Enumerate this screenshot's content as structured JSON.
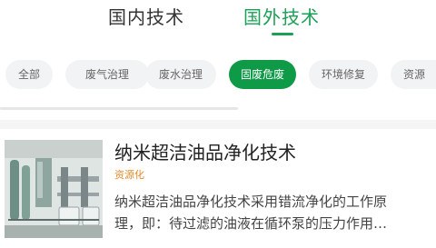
{
  "top_tabs": [
    {
      "label": "国内技术",
      "active": false
    },
    {
      "label": "国外技术",
      "active": true
    }
  ],
  "categories": [
    {
      "label": "全部",
      "active": false
    },
    {
      "label": "废气治理",
      "active": false
    },
    {
      "label": "废水治理",
      "active": false
    },
    {
      "label": "固废危废",
      "active": true
    },
    {
      "label": "环境修复",
      "active": false
    },
    {
      "label": "资源",
      "active": false
    }
  ],
  "article": {
    "title": "纳米超洁油品净化技术",
    "tag": "资源化",
    "summary_line1": "纳米超洁油品净化技术采用错流净化的工作原",
    "summary_line2": "理，即：待过滤的油液在循环泵的压力作用…"
  },
  "colors": {
    "accent": "#1aa057",
    "chip_active": "#0f9a48",
    "tag": "#e58a2b"
  }
}
